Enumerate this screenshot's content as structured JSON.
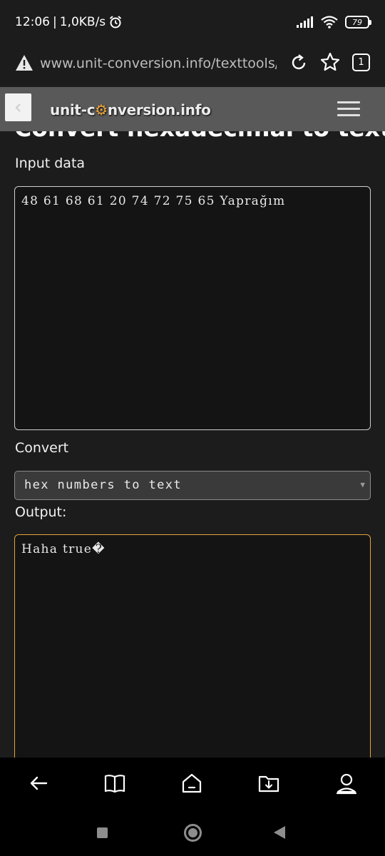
{
  "status_bar": {
    "time": "12:06",
    "separator": "|",
    "speed": "1,0KB/s",
    "battery": "79"
  },
  "browser": {
    "url": "www.unit-conversion.info/texttools/hexadecimal",
    "tab_count": "1"
  },
  "site": {
    "logo_prefix": "unit-c",
    "logo_gear": "⚙",
    "logo_suffix": "nversion.info"
  },
  "page": {
    "title": "Convert hexadecimal to text",
    "input_label": "Input data",
    "input_value": "48 61 68 61 20 74 72 75 65 Yaprağım",
    "convert_label": "Convert",
    "convert_selected": "hex numbers to text",
    "output_label": "Output:",
    "output_value": "Haha true�"
  },
  "colors": {
    "background": "#1c1c1c",
    "header": "#595959",
    "output_border": "#e5a23a",
    "accent_gear": "#f0a43a"
  },
  "icons": {
    "address_bar": [
      "warning-icon",
      "reload-icon",
      "star-icon",
      "tabs-icon"
    ],
    "bottom_bar": [
      "back-arrow-icon",
      "book-icon",
      "home-icon",
      "download-folder-icon",
      "profile-icon"
    ],
    "navigation": [
      "recents-icon",
      "home-circle-icon",
      "back-triangle-icon"
    ]
  }
}
